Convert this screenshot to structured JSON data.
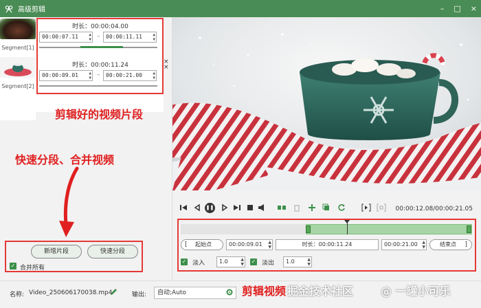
{
  "window": {
    "title": "高级剪辑",
    "controls": [
      "–",
      "□",
      "×"
    ]
  },
  "left": {
    "thumbs": [
      {
        "label": "Segment[1]"
      },
      {
        "label": "Segment[2]"
      }
    ],
    "segments": [
      {
        "duration": "时长：00:00:04.00",
        "start": "00:00:07.11",
        "end": "00:00:11.11",
        "progress": 0.55
      },
      {
        "duration": "时长：00:00:11.24",
        "start": "00:00:09.01",
        "end": "00:00:21.00",
        "progress": 0.0
      }
    ],
    "close_glyph": "×",
    "dash": "–",
    "spin_up": "▲",
    "spin_down": "▼",
    "add_segment_label": "新增片段",
    "quick_split_label": "快速分段",
    "merge_all_label": "合并所有",
    "merge_all_checked": true
  },
  "annotations": {
    "segments_note": "剪辑好的视频片段",
    "quick_note": "快速分段、合并视频",
    "editor_note": "剪辑视频"
  },
  "player": {
    "time_readout": "00:00:12.08/00:00:21.05"
  },
  "editor": {
    "start_btn_label": "起始点",
    "start_value": "00:00:09.01",
    "duration": "时长：00:00:11.24",
    "end_value": "00:00:21.00",
    "end_btn_label": "结束点",
    "fade_in_label": "淡入",
    "fade_in_value": "1.0",
    "fade_out_label": "淡出",
    "fade_out_value": "1.0",
    "range_start_fraction": 0.43,
    "range_end_fraction": 1.0,
    "playhead_fraction": 0.57
  },
  "bottom": {
    "name_label": "名称:",
    "name_value": "Video_250606170038.mp4",
    "output_label": "输出:",
    "output_value": "自动;Auto"
  },
  "watermarks": {
    "left": "掘金技术社区",
    "right": "@ 一罐小可乐"
  },
  "colors": {
    "accent": "#4a8c55",
    "annotation_red": "#e53935"
  }
}
